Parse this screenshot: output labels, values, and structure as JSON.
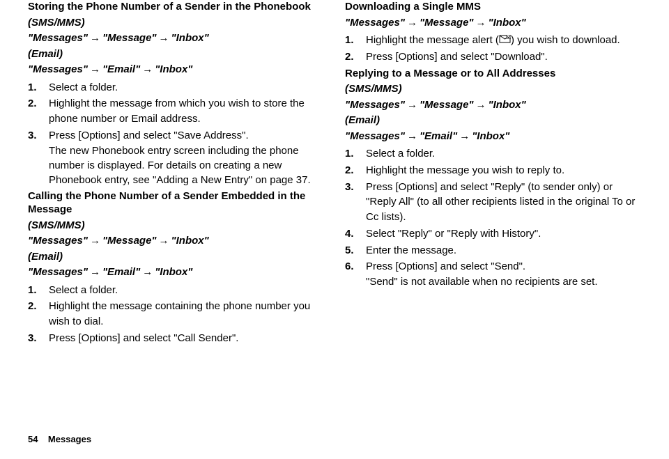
{
  "arrow": "→",
  "left": {
    "section1": {
      "title": "Storing the Phone Number of a Sender in the Phonebook",
      "smsmms_label": "(SMS/MMS)",
      "nav1_a": "\"Messages\"",
      "nav1_b": "\"Message\"",
      "nav1_c": "\"Inbox\"",
      "email_label": "(Email)",
      "nav2_a": "\"Messages\"",
      "nav2_b": "\"Email\"",
      "nav2_c": "\"Inbox\"",
      "steps": {
        "s1": "Select a folder.",
        "s2": "Highlight the message from which you wish to store the phone number or Email address.",
        "s3": "Press [Options] and select \"Save Address\".",
        "s3_note": "The new Phonebook entry screen including the phone number is displayed. For details on creating a new Phonebook entry, see \"Adding a New Entry\" on page 37."
      }
    },
    "section2": {
      "title": "Calling the Phone Number of a Sender Embedded in the Message",
      "smsmms_label": "(SMS/MMS)",
      "nav1_a": "\"Messages\"",
      "nav1_b": "\"Message\"",
      "nav1_c": "\"Inbox\"",
      "email_label": "(Email)",
      "nav2_a": "\"Messages\"",
      "nav2_b": "\"Email\"",
      "nav2_c": "\"Inbox\"",
      "steps": {
        "s1": "Select a folder.",
        "s2": "Highlight the message containing the phone number you wish to dial.",
        "s3": "Press [Options] and select \"Call Sender\"."
      }
    }
  },
  "right": {
    "section1": {
      "title": "Downloading a Single MMS",
      "nav_a": "\"Messages\"",
      "nav_b": "\"Message\"",
      "nav_c": "\"Inbox\"",
      "steps": {
        "s1_before": "Highlight the message alert (",
        "s1_after": ") you wish to download.",
        "s2": "Press [Options] and select \"Download\"."
      }
    },
    "section2": {
      "title": "Replying to a Message or to All Addresses",
      "smsmms_label": "(SMS/MMS)",
      "nav1_a": "\"Messages\"",
      "nav1_b": "\"Message\"",
      "nav1_c": "\"Inbox\"",
      "email_label": "(Email)",
      "nav2_a": "\"Messages\"",
      "nav2_b": "\"Email\"",
      "nav2_c": "\"Inbox\"",
      "steps": {
        "s1": "Select a folder.",
        "s2": "Highlight the message you wish to reply to.",
        "s3": "Press [Options] and select \"Reply\" (to sender only) or \"Reply All\" (to all other recipients listed in the original To or Cc lists).",
        "s4": "Select \"Reply\" or \"Reply with History\".",
        "s5": "Enter the message.",
        "s6": "Press [Options] and select \"Send\".",
        "s6_note": "\"Send\" is not available when no recipients are set."
      }
    }
  },
  "footer": {
    "page": "54",
    "label": "Messages"
  }
}
